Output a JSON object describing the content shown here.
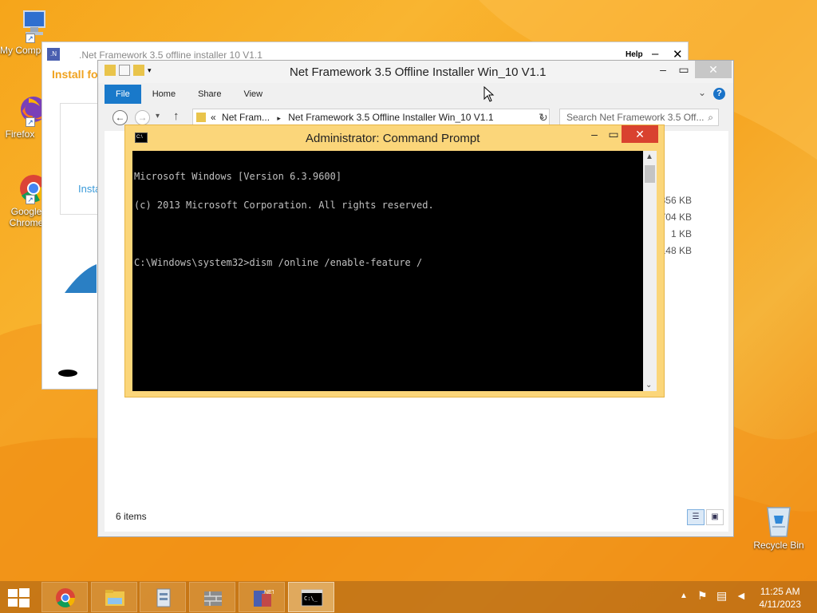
{
  "desktop": {
    "icons": [
      {
        "label": "My Comp",
        "icon": "computer-icon"
      },
      {
        "label": "Firefox",
        "icon": "firefox-icon"
      },
      {
        "label": "Google Chrome",
        "icon": "chrome-icon"
      },
      {
        "label": "Recycle Bin",
        "icon": "recycle-bin-icon"
      }
    ]
  },
  "installer": {
    "title": ".Net Framework 3.5 offline installer 10 V1.1",
    "help": "Help",
    "heading": "Install fo",
    "install_link": "Insta"
  },
  "explorer": {
    "title": "Net Framework 3.5 Offline Installer Win_10 V1.1",
    "tabs": [
      "File",
      "Home",
      "Share",
      "View"
    ],
    "breadcrumb": {
      "prefix": "«",
      "parent": "Net Fram...",
      "separator": "▸",
      "current": "Net Framework 3.5 Offline Installer Win_10 V1.1"
    },
    "search_placeholder": "Search Net Framework 3.5 Off...",
    "file_sizes": [
      "5,356 KB",
      "704 KB",
      "1 KB",
      "148 KB"
    ],
    "status": "6 items"
  },
  "cmd": {
    "title": "Administrator: Command Prompt",
    "lines": [
      "Microsoft Windows [Version 6.3.9600]",
      "(c) 2013 Microsoft Corporation. All rights reserved.",
      "",
      "C:\\Windows\\system32>dism /online /enable-feature /"
    ]
  },
  "taskbar": {
    "items": [
      {
        "name": "chrome",
        "icon": "chrome-icon"
      },
      {
        "name": "file-explorer",
        "icon": "folder-icon"
      },
      {
        "name": "installer-app",
        "icon": "installer-icon"
      },
      {
        "name": "firewall-app",
        "icon": "brick-wall-icon"
      },
      {
        "name": "net-installer",
        "icon": "net-framework-icon"
      },
      {
        "name": "command-prompt",
        "icon": "cmd-icon"
      }
    ],
    "time": "11:25 AM",
    "date": "4/11/2023"
  },
  "colors": {
    "accent": "#1979ca",
    "cmd_frame": "#fbd67a",
    "taskbar": "#be6e14"
  }
}
